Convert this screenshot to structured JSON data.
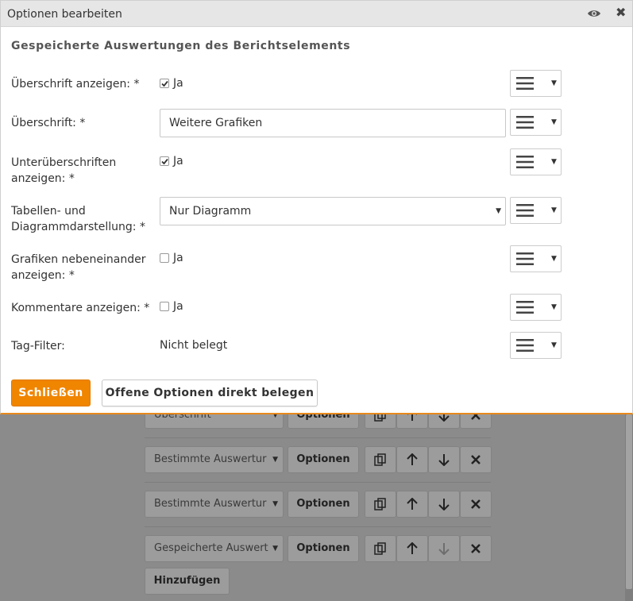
{
  "dialog": {
    "title": "Optionen bearbeiten",
    "section_title": "Gespeicherte Auswertungen des Berichtselements",
    "fields": [
      {
        "label": "Überschrift anzeigen: *",
        "checked": true,
        "option_label": "Ja"
      },
      {
        "label": "Überschrift: *",
        "value": "Weitere Grafiken"
      },
      {
        "label": "Unterüberschriften anzeigen: *",
        "checked": true,
        "option_label": "Ja"
      },
      {
        "label": "Tabellen- und Diagrammdarstellung: *",
        "selected": "Nur Diagramm"
      },
      {
        "label": "Grafiken nebeneinander anzeigen: *",
        "checked": false,
        "option_label": "Ja"
      },
      {
        "label": "Kommentare anzeigen: *",
        "checked": false,
        "option_label": "Ja"
      },
      {
        "label": "Tag-Filter:",
        "value": "Nicht belegt"
      }
    ],
    "buttons": {
      "close_label": "Schließen",
      "assign_label": "Offene Optionen direkt belegen"
    },
    "icons": {
      "eye": "eye-icon",
      "close": "close-icon",
      "menu": "hamburger-menu-icon"
    },
    "colors": {
      "primary": "#f08500",
      "titlebar": "#e6e6e6",
      "accent_border": "#e8891b"
    }
  },
  "background": {
    "rows": [
      {
        "select": "Überschrift",
        "options_label": "Optionen"
      },
      {
        "select": "Bestimmte Auswertur",
        "options_label": "Optionen"
      },
      {
        "select": "Bestimmte Auswertur",
        "options_label": "Optionen"
      },
      {
        "select": "Gespeicherte Auswert",
        "options_label": "Optionen"
      }
    ],
    "add_label": "Hinzufügen"
  }
}
